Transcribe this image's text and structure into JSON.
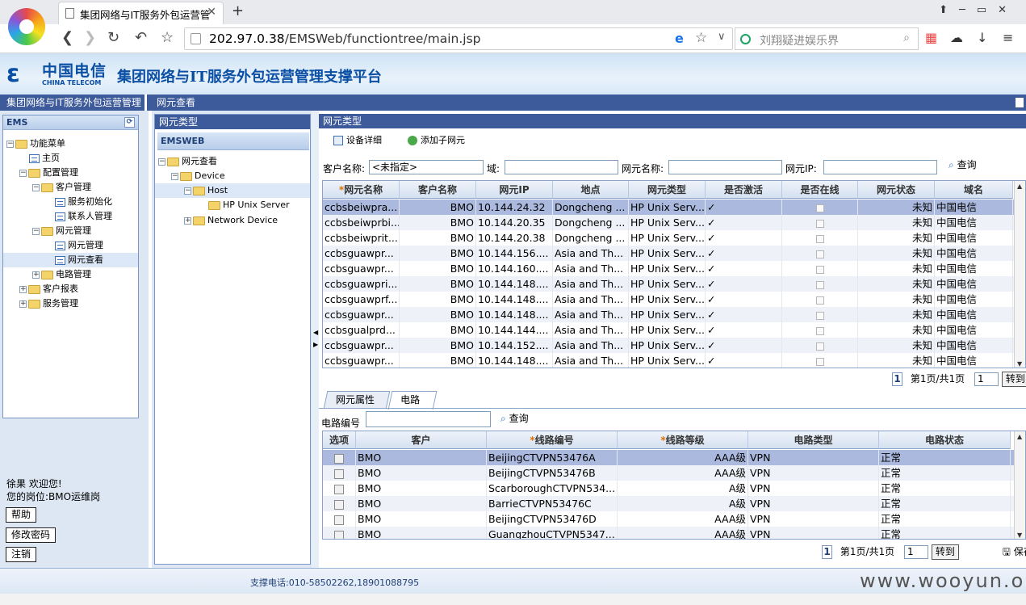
{
  "browser": {
    "tab_title": "集团网络与IT服务外包运营管",
    "url_host": "202.97.0.38",
    "url_path": "/EMSWeb/functiontree/main.jsp",
    "search_placeholder": "刘翔疑进娱乐界"
  },
  "header": {
    "logo_cn": "中国电信",
    "logo_en": "CHINA TELECOM",
    "title": "集团网络与IT服务外包运营管理支撑平台"
  },
  "bar": {
    "left_title": "集团网络与IT服务外包运营管理",
    "right_title": "网元查看"
  },
  "left": {
    "header": "EMS",
    "tree": [
      {
        "label": "功能菜单"
      },
      {
        "label": "主页"
      },
      {
        "label": "配置管理"
      },
      {
        "label": "客户管理"
      },
      {
        "label": "服务初始化"
      },
      {
        "label": "联系人管理"
      },
      {
        "label": "网元管理"
      },
      {
        "label": "网元管理"
      },
      {
        "label": "网元查看"
      },
      {
        "label": "电路管理"
      },
      {
        "label": "客户报表"
      },
      {
        "label": "服务管理"
      }
    ],
    "user_line": "徐果  欢迎您!",
    "post_line": "您的岗位:BMO运维岗",
    "help": "帮助",
    "change_pwd": "修改密码",
    "logout": "注销"
  },
  "mid": {
    "header": "网元类型",
    "subheader": "EMSWEB",
    "tree": [
      {
        "label": "网元查看"
      },
      {
        "label": "Device"
      },
      {
        "label": "Host"
      },
      {
        "label": "HP Unix Server"
      },
      {
        "label": "Network Device"
      }
    ]
  },
  "right": {
    "header": "网元类型",
    "tool_detail": "设备详细",
    "tool_add": "添加子网元",
    "filters": {
      "customer_label": "客户名称:",
      "customer_value": "<未指定>",
      "domain_label": "域:",
      "ne_name_label": "网元名称:",
      "ne_ip_label": "网元IP:",
      "query": "查询"
    },
    "columns": [
      "网元名称",
      "客户名称",
      "网元IP",
      "地点",
      "网元类型",
      "是否激活",
      "是否在线",
      "网元状态",
      "域名"
    ],
    "rows": [
      [
        "ccbsbeiwpra...",
        "BMO",
        "10.144.24.32",
        "Dongcheng ...",
        "HP Unix Serv...",
        "✓",
        "",
        "未知",
        "中国电信"
      ],
      [
        "ccbsbeiwprbi...",
        "BMO",
        "10.144.20.35",
        "Dongcheng ...",
        "HP Unix Serv...",
        "✓",
        "",
        "未知",
        "中国电信"
      ],
      [
        "ccbsbeiwprit...",
        "BMO",
        "10.144.20.38",
        "Dongcheng ...",
        "HP Unix Serv...",
        "✓",
        "",
        "未知",
        "中国电信"
      ],
      [
        "ccbsguawpr...",
        "BMO",
        "10.144.156....",
        "Asia and Th...",
        "HP Unix Serv...",
        "✓",
        "",
        "未知",
        "中国电信"
      ],
      [
        "ccbsguawpr...",
        "BMO",
        "10.144.160....",
        "Asia and Th...",
        "HP Unix Serv...",
        "✓",
        "",
        "未知",
        "中国电信"
      ],
      [
        "ccbsguawpri...",
        "BMO",
        "10.144.148....",
        "Asia and Th...",
        "HP Unix Serv...",
        "✓",
        "",
        "未知",
        "中国电信"
      ],
      [
        "ccbsguawprf...",
        "BMO",
        "10.144.148....",
        "Asia and Th...",
        "HP Unix Serv...",
        "✓",
        "",
        "未知",
        "中国电信"
      ],
      [
        "ccbsguawpr...",
        "BMO",
        "10.144.148....",
        "Asia and Th...",
        "HP Unix Serv...",
        "✓",
        "",
        "未知",
        "中国电信"
      ],
      [
        "ccbsgualprd...",
        "BMO",
        "10.144.144....",
        "Asia and Th...",
        "HP Unix Serv...",
        "✓",
        "",
        "未知",
        "中国电信"
      ],
      [
        "ccbsguawpr...",
        "BMO",
        "10.144.152....",
        "Asia and Th...",
        "HP Unix Serv...",
        "✓",
        "",
        "未知",
        "中国电信"
      ],
      [
        "ccbsguawpr...",
        "BMO",
        "10.144.148....",
        "Asia and Th...",
        "HP Unix Serv...",
        "✓",
        "",
        "未知",
        "中国电信"
      ]
    ],
    "pager1": {
      "page": "1",
      "text": "第1页/共1页",
      "input": "1",
      "go": "转到"
    },
    "tabs": [
      "网元属性",
      "电路"
    ],
    "circuit_label": "电路编号",
    "circuit_query": "查询",
    "columns2": [
      "选项",
      "客户",
      "线路编号",
      "线路等级",
      "电路类型",
      "电路状态"
    ],
    "rows2": [
      [
        "",
        "BMO",
        "BeijingCTVPN53476A",
        "AAA级",
        "VPN",
        "正常"
      ],
      [
        "",
        "BMO",
        "BeijingCTVPN53476B",
        "AAA级",
        "VPN",
        "正常"
      ],
      [
        "",
        "BMO",
        "ScarboroughCTVPN534...",
        "A级",
        "VPN",
        "正常"
      ],
      [
        "",
        "BMO",
        "BarrieCTVPN53476C",
        "A级",
        "VPN",
        "正常"
      ],
      [
        "",
        "BMO",
        "BeijingCTVPN53476D",
        "AAA级",
        "VPN",
        "正常"
      ],
      [
        "",
        "BMO",
        "GuangzhouCTVPN5347...",
        "AAA级",
        "VPN",
        "正常"
      ]
    ],
    "pager2": {
      "page": "1",
      "text": "第1页/共1页",
      "input": "1",
      "go": "转到",
      "save": "保存"
    }
  },
  "footer": {
    "phone": "支撑电话:010-58502262,18901088795",
    "watermark": "www.wooyun.org"
  }
}
